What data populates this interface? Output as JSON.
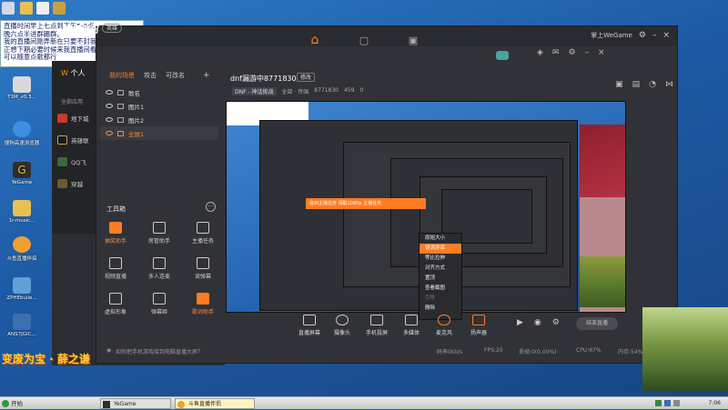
{
  "desktop": {
    "icons": [
      {
        "label": "T1M_v0.3...",
        "color": "#d9d9d9"
      },
      {
        "label": "搜狗高速浏览器",
        "color": "#3d8fe0"
      },
      {
        "label": "YeGame",
        "color": "#2f2f2f"
      },
      {
        "label": "1r-music...",
        "color": "#e8c050"
      },
      {
        "label": "斗鱼直播伴侣",
        "color": "#f0a030"
      },
      {
        "label": "ZPHEbuile...",
        "color": "#5fa0d8"
      },
      {
        "label": "ANS7JGIC...",
        "color": "#3d6fb0"
      }
    ],
    "note_lines": [
      "直播时间早上七点到下午5-6点",
      "晚六点半进群踢群。",
      "我的直播间刚弄新在只要不封我直播间就行",
      "正想下期必要时候来我直播间看看",
      "可以随意点歌都行"
    ],
    "logo_text": "变废为宝 · 薛之谦"
  },
  "assistant": {
    "header_title": "个人",
    "section_label": "全部应用",
    "items": [
      {
        "label": "地下城",
        "color": "#c93a2a"
      },
      {
        "label": "英雄联",
        "color": "#1a1a1a"
      },
      {
        "label": "QQ飞",
        "color": "#3a6a3a"
      },
      {
        "label": "穿越",
        "color": "#6a5a30"
      }
    ]
  },
  "window": {
    "brand": "直播伴侣",
    "mode": "英雄",
    "wegame_label": "掌上WeGame",
    "tabs": [
      "我的场景",
      "攻击",
      "可改名"
    ],
    "scenes": [
      {
        "label": "歌名"
      },
      {
        "label": "图片1"
      },
      {
        "label": "图片2"
      },
      {
        "label": "全屏1"
      }
    ],
    "room_title": "dnf漏游中8771830",
    "room_edit": "修改",
    "room_meta": {
      "tag": "DNF - 神话挑战",
      "category": "全部 · 传国",
      "room_id": "8771830",
      "viewers": "459",
      "likes": "0"
    },
    "tools_title": "工具箱",
    "tools": [
      {
        "label": "抽奖助手",
        "active": true
      },
      {
        "label": "房管助手",
        "active": false
      },
      {
        "label": "主播任务",
        "active": false
      },
      {
        "label": "视频直播",
        "active": false
      },
      {
        "label": "多人连麦",
        "active": false
      },
      {
        "label": "读弹幕",
        "active": false
      },
      {
        "label": "虚拟形象",
        "active": false
      },
      {
        "label": "弹幕姬",
        "active": false
      },
      {
        "label": "歌词助手",
        "active": true
      }
    ],
    "bottom_actions": [
      "直播屏幕",
      "摄像头",
      "手机投屏",
      "多媒体",
      "麦克风",
      "扬声器"
    ],
    "live_button": "结束直播",
    "status": {
      "hint": "如何把手机游戏接到电脑直播大屏？",
      "bitrate": "码率0kb/s",
      "fps": "FPS:20",
      "drop": "丢帧:0(0.00%)",
      "cpu": "CPU:67%",
      "mem": "内存:54%"
    },
    "context_menu": [
      "原始大小",
      "铺满屏幕",
      "等比拉伸",
      "对齐方式",
      "置顶",
      "查看截图",
      "引导",
      "删除"
    ],
    "orange_strip": "找到主播任务   领取1080p   主播任务"
  },
  "taskbar": {
    "start": "开始",
    "items": [
      "YeGame",
      "斗鱼直播伴侣"
    ],
    "clock": "7:06"
  },
  "colors": {
    "accent": "#ff7c24",
    "desktop": "#1d5aa4",
    "panel": "#303237"
  }
}
